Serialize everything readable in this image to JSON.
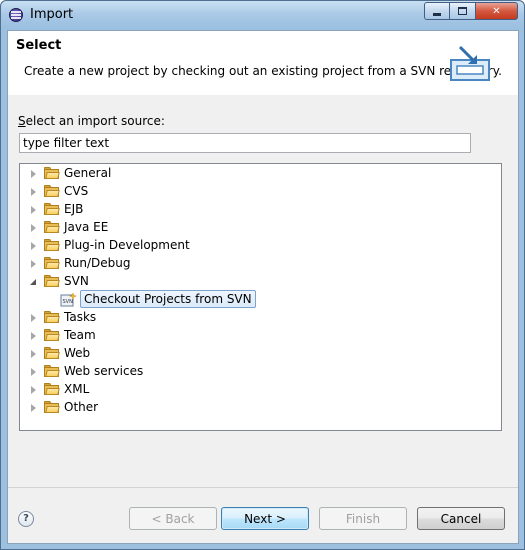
{
  "window": {
    "title": "Import",
    "icon": "eclipse-icon"
  },
  "header": {
    "title": "Select",
    "description": "Create a new project by checking out an existing project from a SVN repository.",
    "icon": "import-wizard-icon"
  },
  "source": {
    "label_prefix": "S",
    "label_rest": "elect an import source:",
    "filter_value": "type filter text"
  },
  "tree": {
    "nodes": [
      {
        "label": "General",
        "expanded": false
      },
      {
        "label": "CVS",
        "expanded": false
      },
      {
        "label": "EJB",
        "expanded": false
      },
      {
        "label": "Java EE",
        "expanded": false
      },
      {
        "label": "Plug-in Development",
        "expanded": false
      },
      {
        "label": "Run/Debug",
        "expanded": false
      },
      {
        "label": "SVN",
        "expanded": true,
        "children": [
          {
            "label": "Checkout Projects from SVN",
            "selected": true
          }
        ]
      },
      {
        "label": "Tasks",
        "expanded": false
      },
      {
        "label": "Team",
        "expanded": false
      },
      {
        "label": "Web",
        "expanded": false
      },
      {
        "label": "Web services",
        "expanded": false
      },
      {
        "label": "XML",
        "expanded": false
      },
      {
        "label": "Other",
        "expanded": false
      }
    ]
  },
  "buttons": {
    "help": "?",
    "back": "< Back",
    "next": "Next >",
    "finish": "Finish",
    "cancel": "Cancel"
  }
}
